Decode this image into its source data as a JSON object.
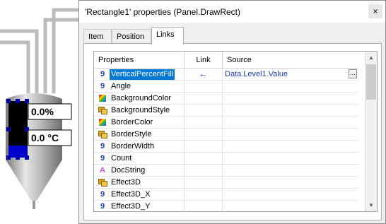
{
  "dialog": {
    "title": "'Rectangle1' properties (Panel.DrawRect)",
    "close_label": "×"
  },
  "tabs": [
    {
      "label": "Item",
      "active": false
    },
    {
      "label": "Position",
      "active": false
    },
    {
      "label": "Links",
      "active": true
    }
  ],
  "grid": {
    "headers": {
      "properties": "Properties",
      "link": "Link",
      "source": "Source"
    },
    "rows": [
      {
        "icon": "number-icon",
        "glyph": "9",
        "name": "VerticalPercentFill",
        "selected": true,
        "link": "←",
        "source": "Data.Level1.Value",
        "source_button": "..."
      },
      {
        "icon": "number-icon",
        "glyph": "9",
        "name": "Angle"
      },
      {
        "icon": "color-icon",
        "glyph": "",
        "name": "BackgroundColor"
      },
      {
        "icon": "enum-icon",
        "glyph": "",
        "name": "BackgroundStyle"
      },
      {
        "icon": "color-icon",
        "glyph": "",
        "name": "BorderColor"
      },
      {
        "icon": "enum-icon",
        "glyph": "",
        "name": "BorderStyle"
      },
      {
        "icon": "number-icon",
        "glyph": "9",
        "name": "BorderWidth"
      },
      {
        "icon": "number-icon",
        "glyph": "9",
        "name": "Count"
      },
      {
        "icon": "string-icon",
        "glyph": "A",
        "name": "DocString"
      },
      {
        "icon": "enum-icon",
        "glyph": "",
        "name": "Effect3D"
      },
      {
        "icon": "number-icon",
        "glyph": "9",
        "name": "Effect3D_X"
      },
      {
        "icon": "number-icon",
        "glyph": "9",
        "name": "Effect3D_Y"
      }
    ]
  },
  "canvas": {
    "percent_value": "0.0%",
    "temperature_value": "0.0 °C",
    "fill_fraction": 0.0
  },
  "colors": {
    "selection": "#0078d7",
    "link_blue": "#1a3fb5"
  }
}
